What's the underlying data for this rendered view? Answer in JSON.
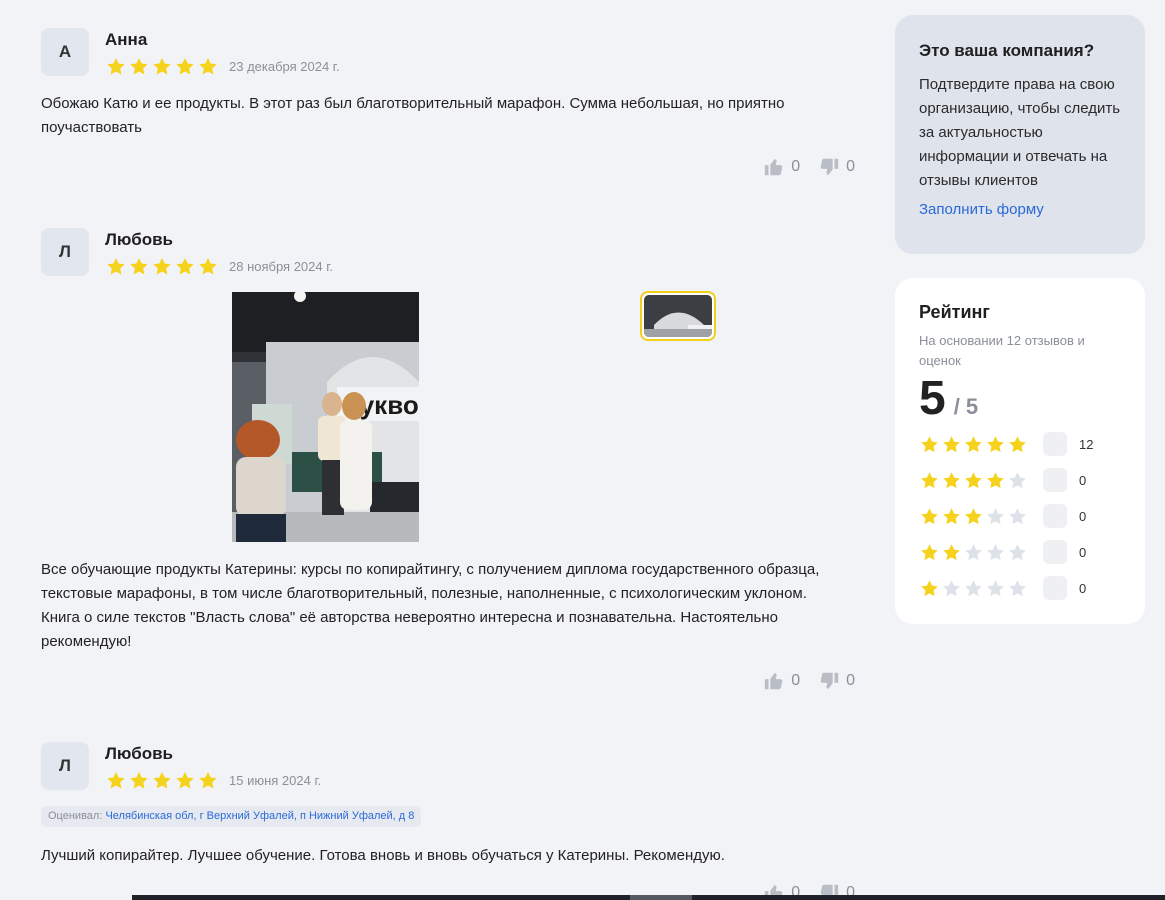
{
  "colors": {
    "star_filled": "#f5d21b",
    "star_empty": "#dde1e8",
    "link": "#2a6ad8",
    "background": "#f2f3f6"
  },
  "reviews": [
    {
      "initial": "А",
      "author": "Анна",
      "rating": 5,
      "date": "23 декабря 2024 г.",
      "text": "Обожаю Катю и ее продукты. В этот раз был благотворительный марафон. Сумма небольшая, но приятно поучаствовать",
      "likes": "0",
      "dislikes": "0"
    },
    {
      "initial": "Л",
      "author": "Любовь",
      "rating": 5,
      "date": "28 ноября 2024 г.",
      "photo_sign": "буквоед",
      "text": "Все обучающие продукты Катерины: курсы по копирайтингу, с получением диплома государственного образца, текстовые марафоны, в том числе благотворительный, полезные, наполненные, с психологическим уклоном. Книга о силе текстов \"Власть слова\" её авторства невероятно интересна и познавательна. Настоятельно рекомендую!",
      "likes": "0",
      "dislikes": "0"
    },
    {
      "initial": "Л",
      "author": "Любовь",
      "rating": 5,
      "date": "15 июня 2024 г.",
      "evaluated_label": "Оценивал:",
      "evaluated_address": "Челябинская обл, г Верхний Уфалей, п Нижний Уфалей, д 8",
      "text": "Лучший копирайтер. Лучшее обучение. Готова вновь и вновь обучаться у Катерины. Рекомендую.",
      "likes": "0",
      "dislikes": "0"
    }
  ],
  "company_card": {
    "title": "Это ваша компания?",
    "text": "Подтвердите права на свою организацию, чтобы следить за актуальностью информации и отвечать на отзывы клиентов",
    "link": "Заполнить форму"
  },
  "rating_card": {
    "title": "Рейтинг",
    "basis": "На основании 12 отзывов и оценок",
    "score": "5",
    "score_of": "/ 5",
    "distribution": [
      {
        "stars": 5,
        "count": "12"
      },
      {
        "stars": 4,
        "count": "0"
      },
      {
        "stars": 3,
        "count": "0"
      },
      {
        "stars": 2,
        "count": "0"
      },
      {
        "stars": 1,
        "count": "0"
      }
    ]
  }
}
